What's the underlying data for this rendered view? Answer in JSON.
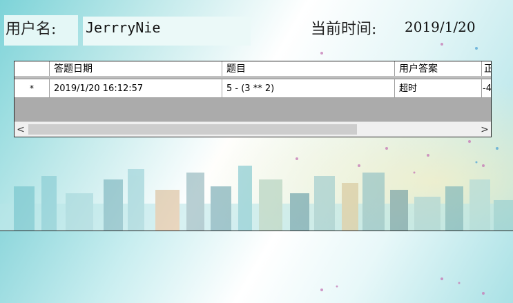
{
  "header": {
    "username_label": "用户名:",
    "username_value": "JerrryNie",
    "time_label": "当前时间:",
    "time_value": "2019/1/20"
  },
  "grid": {
    "columns": [
      "答题日期",
      "题目",
      "用户答案",
      "正"
    ],
    "rows": [
      {
        "selector": "*",
        "date": "2019/1/20 16:12:57",
        "question": "5 - (3 ** 2)",
        "answer": "超时",
        "correct": "-4"
      }
    ],
    "scroll_left": "<",
    "scroll_right": ">"
  },
  "colors": {
    "field_bg": "#ebf9f8",
    "grid_empty_bg": "#ababab",
    "scrollbar_bg": "#f0f0f0"
  }
}
